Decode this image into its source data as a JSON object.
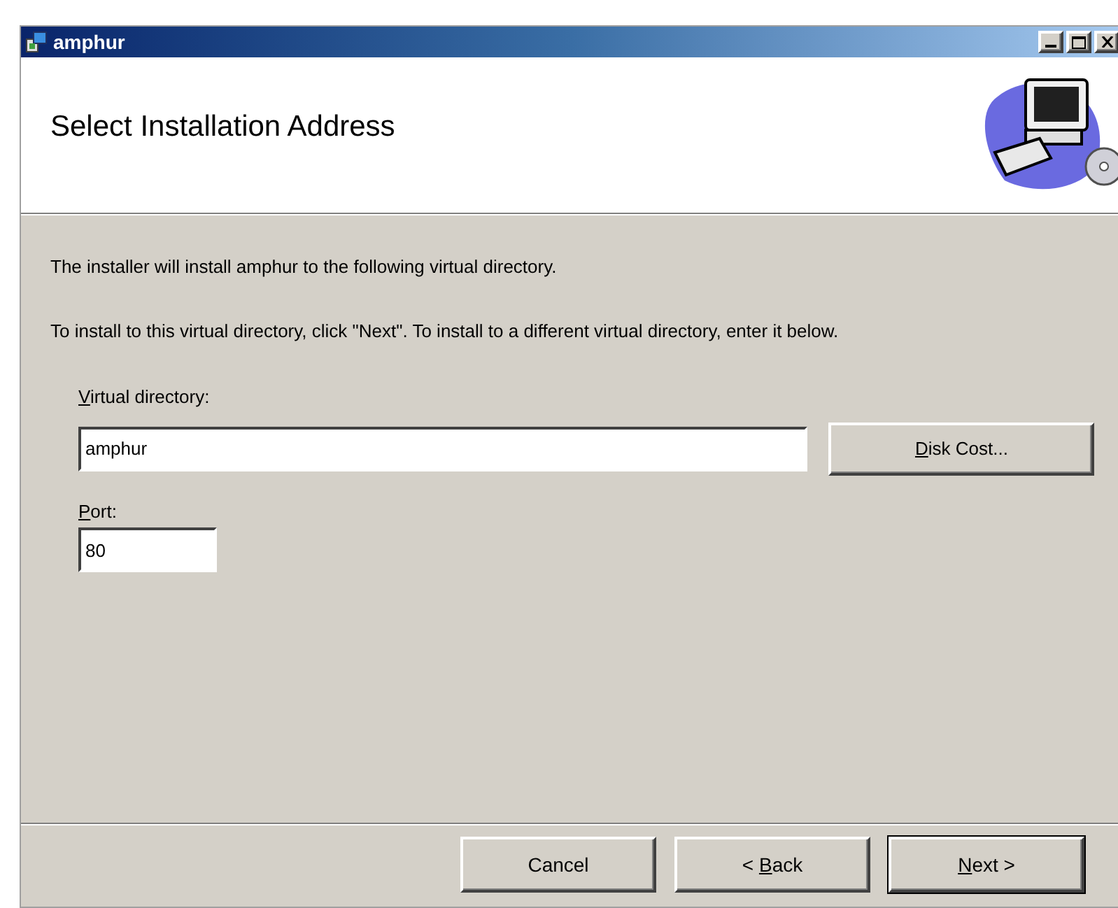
{
  "window": {
    "title": "amphur"
  },
  "header": {
    "title": "Select Installation Address"
  },
  "body": {
    "intro": "The installer will install amphur to the following virtual directory.",
    "instruction": "To install to this virtual directory, click \"Next\". To install to a different virtual directory, enter it below.",
    "directory": {
      "label": "Virtual directory:",
      "value": "amphur"
    },
    "disk_cost_button": {
      "label": "Disk Cost..."
    },
    "port": {
      "label": "Port:",
      "value": "80"
    }
  },
  "buttons": [
    {
      "label": "Cancel",
      "default": false
    },
    {
      "label": "< Back",
      "default": false
    },
    {
      "label": "Next >",
      "default": true
    }
  ]
}
